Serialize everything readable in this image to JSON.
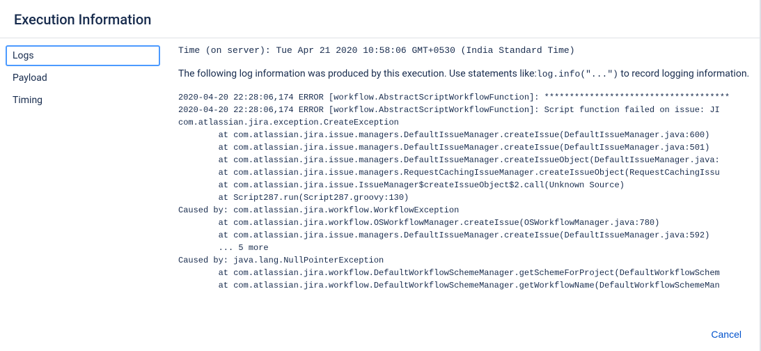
{
  "header": {
    "title": "Execution Information"
  },
  "sidebar": {
    "tabs": [
      {
        "label": "Logs",
        "active": true
      },
      {
        "label": "Payload",
        "active": false
      },
      {
        "label": "Timing",
        "active": false
      }
    ]
  },
  "content": {
    "time_prefix": "Time (on server): ",
    "time_value": "Tue Apr 21 2020 10:58:06 GMT+0530 (India Standard Time)",
    "intro_part1": "The following log information was produced by this execution. Use statements like:",
    "intro_code": "log.info(\"...\")",
    "intro_part2": " to record logging information.",
    "log_text": "2020-04-20 22:28:06,174 ERROR [workflow.AbstractScriptWorkflowFunction]: *************************************\n2020-04-20 22:28:06,174 ERROR [workflow.AbstractScriptWorkflowFunction]: Script function failed on issue: JI\ncom.atlassian.jira.exception.CreateException\n        at com.atlassian.jira.issue.managers.DefaultIssueManager.createIssue(DefaultIssueManager.java:600)\n        at com.atlassian.jira.issue.managers.DefaultIssueManager.createIssue(DefaultIssueManager.java:501)\n        at com.atlassian.jira.issue.managers.DefaultIssueManager.createIssueObject(DefaultIssueManager.java:\n        at com.atlassian.jira.issue.managers.RequestCachingIssueManager.createIssueObject(RequestCachingIssu\n        at com.atlassian.jira.issue.IssueManager$createIssueObject$2.call(Unknown Source)\n        at Script287.run(Script287.groovy:130)\nCaused by: com.atlassian.jira.workflow.WorkflowException\n        at com.atlassian.jira.workflow.OSWorkflowManager.createIssue(OSWorkflowManager.java:780)\n        at com.atlassian.jira.issue.managers.DefaultIssueManager.createIssue(DefaultIssueManager.java:592)\n        ... 5 more\nCaused by: java.lang.NullPointerException\n        at com.atlassian.jira.workflow.DefaultWorkflowSchemeManager.getSchemeForProject(DefaultWorkflowSchem\n        at com.atlassian.jira.workflow.DefaultWorkflowSchemeManager.getWorkflowName(DefaultWorkflowSchemeMan"
  },
  "footer": {
    "cancel_label": "Cancel"
  }
}
